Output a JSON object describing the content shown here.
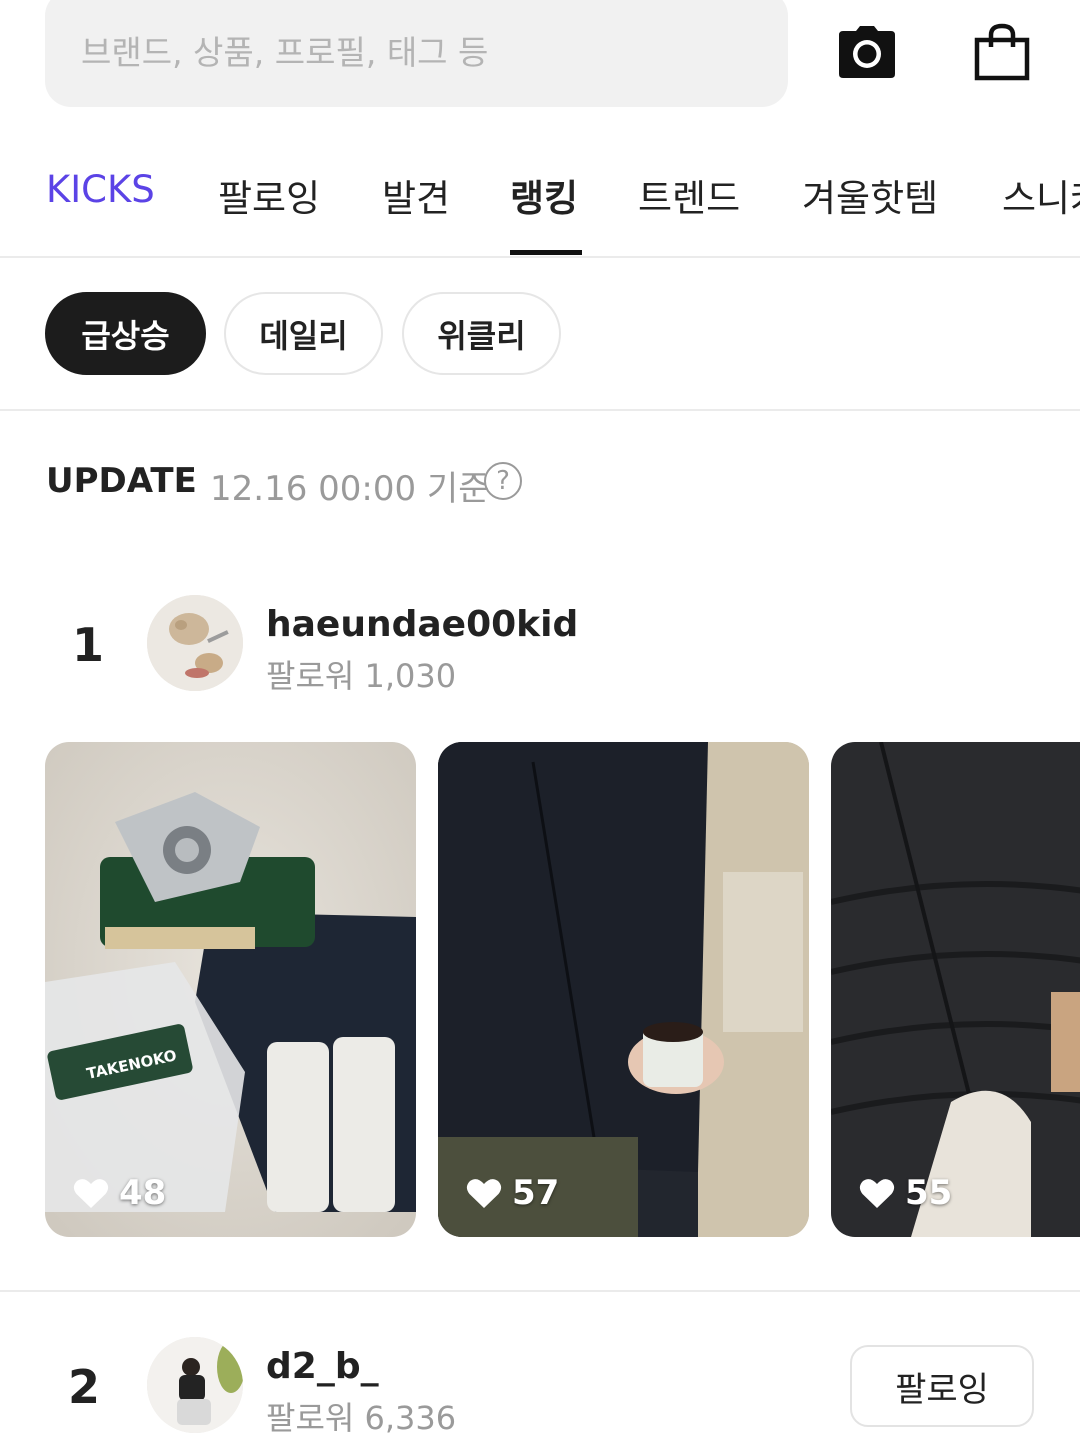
{
  "search": {
    "placeholder": "브랜드, 상품, 프로필, 태그 등"
  },
  "header_icons": {
    "camera": "camera-icon",
    "bag": "shopping-bag-icon"
  },
  "tabs": [
    {
      "label": "KICKS",
      "active": false
    },
    {
      "label": "팔로잉",
      "active": false
    },
    {
      "label": "발견",
      "active": false
    },
    {
      "label": "랭킹",
      "active": true
    },
    {
      "label": "트렌드",
      "active": false
    },
    {
      "label": "겨울핫템",
      "active": false
    },
    {
      "label": "스니커즈",
      "active": false
    }
  ],
  "filters": [
    {
      "label": "급상승",
      "active": true
    },
    {
      "label": "데일리",
      "active": false
    },
    {
      "label": "위클리",
      "active": false
    }
  ],
  "update": {
    "label": "UPDATE",
    "time": "12.16 00:00 기준",
    "help": "?"
  },
  "rankings": [
    {
      "rank": "1",
      "username": "haeundae00kid",
      "followers": "팔로워 1,030",
      "posts": [
        {
          "likes": "48"
        },
        {
          "likes": "57"
        },
        {
          "likes": "55"
        }
      ]
    },
    {
      "rank": "2",
      "username": "d2_b_",
      "followers": "팔로워 6,336",
      "follow_label": "팔로잉"
    }
  ],
  "colors": {
    "brand_tab": "#5b43e6",
    "active_chip": "#1c1c1c"
  }
}
